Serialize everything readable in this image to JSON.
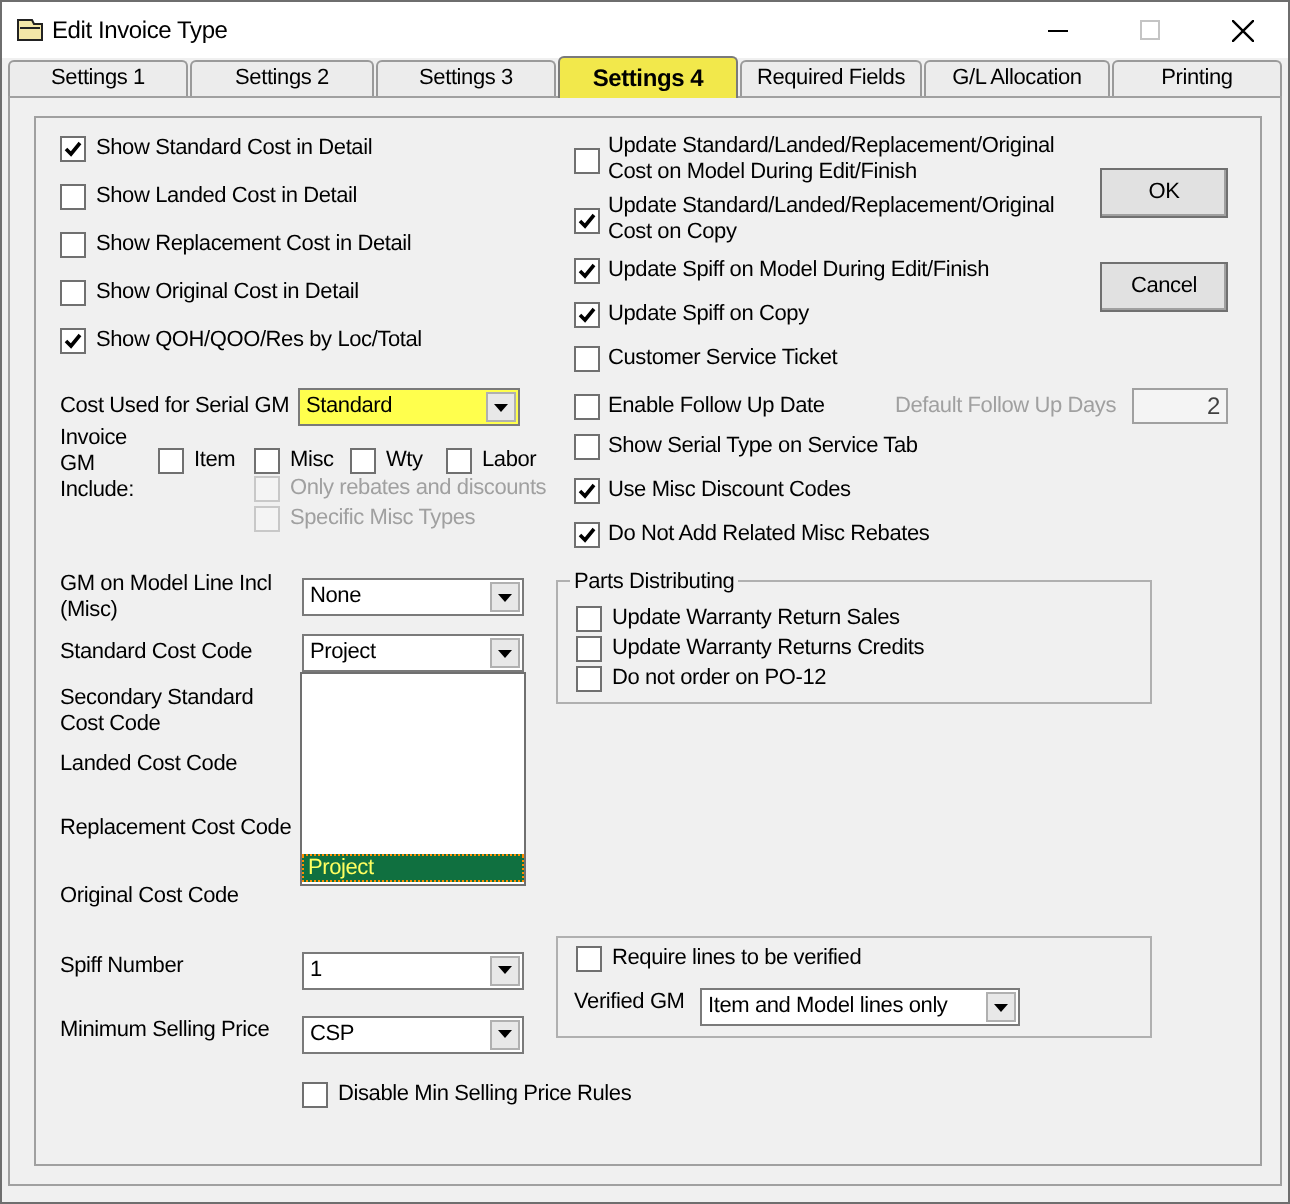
{
  "window": {
    "title": "Edit Invoice Type"
  },
  "tabs": [
    {
      "label": "Settings 1",
      "selected": false
    },
    {
      "label": "Settings 2",
      "selected": false
    },
    {
      "label": "Settings 3",
      "selected": false
    },
    {
      "label": "Settings 4",
      "selected": true
    },
    {
      "label": "Required Fields",
      "selected": false
    },
    {
      "label": "G/L Allocation",
      "selected": false
    },
    {
      "label": "Printing",
      "selected": false
    }
  ],
  "display_options": [
    {
      "label": "Show Standard Cost in Detail",
      "checked": true
    },
    {
      "label": "Show Landed Cost in Detail",
      "checked": false
    },
    {
      "label": "Show Replacement Cost in Detail",
      "checked": false
    },
    {
      "label": "Show Original Cost in Detail",
      "checked": false
    },
    {
      "label": "Show QOH/QOO/Res by Loc/Total",
      "checked": true
    }
  ],
  "cost_used_for_serial_gm": {
    "label": "Cost Used for Serial GM",
    "value": "Standard",
    "highlighted": true
  },
  "invoice_gm_include": {
    "label": "Invoice GM Include:",
    "options": [
      {
        "label": "Item",
        "checked": false,
        "disabled": false
      },
      {
        "label": "Misc",
        "checked": false,
        "disabled": false
      },
      {
        "label": "Wty",
        "checked": false,
        "disabled": false
      },
      {
        "label": "Labor",
        "checked": false,
        "disabled": false
      }
    ],
    "sub_options": [
      {
        "label": "Only rebates and discounts",
        "checked": false,
        "disabled": true
      },
      {
        "label": "Specific Misc Types",
        "checked": false,
        "disabled": true
      }
    ]
  },
  "gm_on_model_line": {
    "label": "GM on Model Line Incl (Misc)",
    "value": "None"
  },
  "standard_cost_code": {
    "label": "Standard Cost Code",
    "value": "Project",
    "expanded": true,
    "list_items": [
      {
        "label": "Project",
        "selected": true
      }
    ]
  },
  "cost_code_labels": [
    "Secondary Standard Cost Code",
    "Landed Cost Code",
    "Replacement Cost Code",
    "Original Cost Code"
  ],
  "spiff_number": {
    "label": "Spiff Number",
    "value": "1"
  },
  "minimum_selling_price": {
    "label": "Minimum Selling Price",
    "value": "CSP"
  },
  "disable_min_selling_price_rules": {
    "label": "Disable Min Selling Price Rules",
    "checked": false
  },
  "update_options": [
    {
      "label": "Update Standard/Landed/Replacement/Original Cost on Model During Edit/Finish",
      "checked": false
    },
    {
      "label": "Update Standard/Landed/Replacement/Original Cost on Copy",
      "checked": true
    },
    {
      "label": "Update Spiff on Model During Edit/Finish",
      "checked": true
    },
    {
      "label": "Update Spiff on Copy",
      "checked": true
    },
    {
      "label": "Customer Service Ticket",
      "checked": false
    },
    {
      "label": "Enable Follow Up Date",
      "checked": false,
      "follow_up_days": {
        "label": "Default Follow Up Days",
        "value": "2",
        "disabled": true
      }
    },
    {
      "label": "Show Serial Type on Service Tab",
      "checked": false
    },
    {
      "label": "Use Misc Discount Codes",
      "checked": true
    },
    {
      "label": "Do Not Add Related Misc Rebates",
      "checked": true
    }
  ],
  "buttons": [
    "OK",
    "Cancel"
  ],
  "parts_distributing": {
    "title": "Parts Distributing",
    "options": [
      {
        "label": "Update Warranty Return Sales",
        "checked": false
      },
      {
        "label": "Update Warranty Returns Credits",
        "checked": false
      },
      {
        "label": "Do not order on PO-12",
        "checked": false
      }
    ]
  },
  "verification": {
    "require": {
      "label": "Require lines to be verified",
      "checked": false
    },
    "verified_gm": {
      "label": "Verified GM",
      "value": "Item and Model lines only"
    }
  }
}
